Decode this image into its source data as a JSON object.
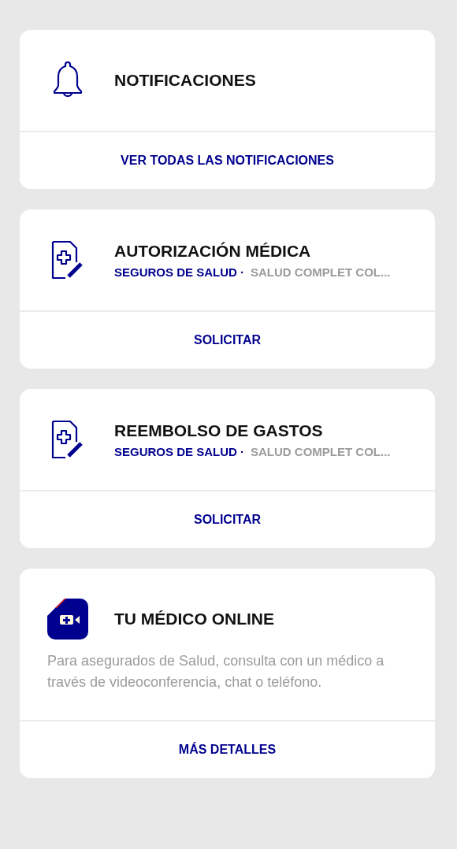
{
  "cards": [
    {
      "kind": "bell",
      "title": "NOTIFICACIONES",
      "action": "VER TODAS LAS NOTIFICACIONES"
    },
    {
      "kind": "form",
      "title": "AUTORIZACIÓN MÉDICA",
      "category": "SEGUROS DE SALUD ·",
      "plan": "SALUD COMPLET COL...",
      "action": "SOLICITAR"
    },
    {
      "kind": "form",
      "title": "REEMBOLSO DE GASTOS",
      "category": "SEGUROS DE SALUD ·",
      "plan": "SALUD COMPLET COL...",
      "action": "SOLICITAR"
    },
    {
      "kind": "video",
      "title": "TU MÉDICO ONLINE",
      "description": "Para asegurados de Salud, consulta con un médico a través de videoconferencia, chat o teléfono.",
      "action": "MÁS DETALLES"
    }
  ]
}
